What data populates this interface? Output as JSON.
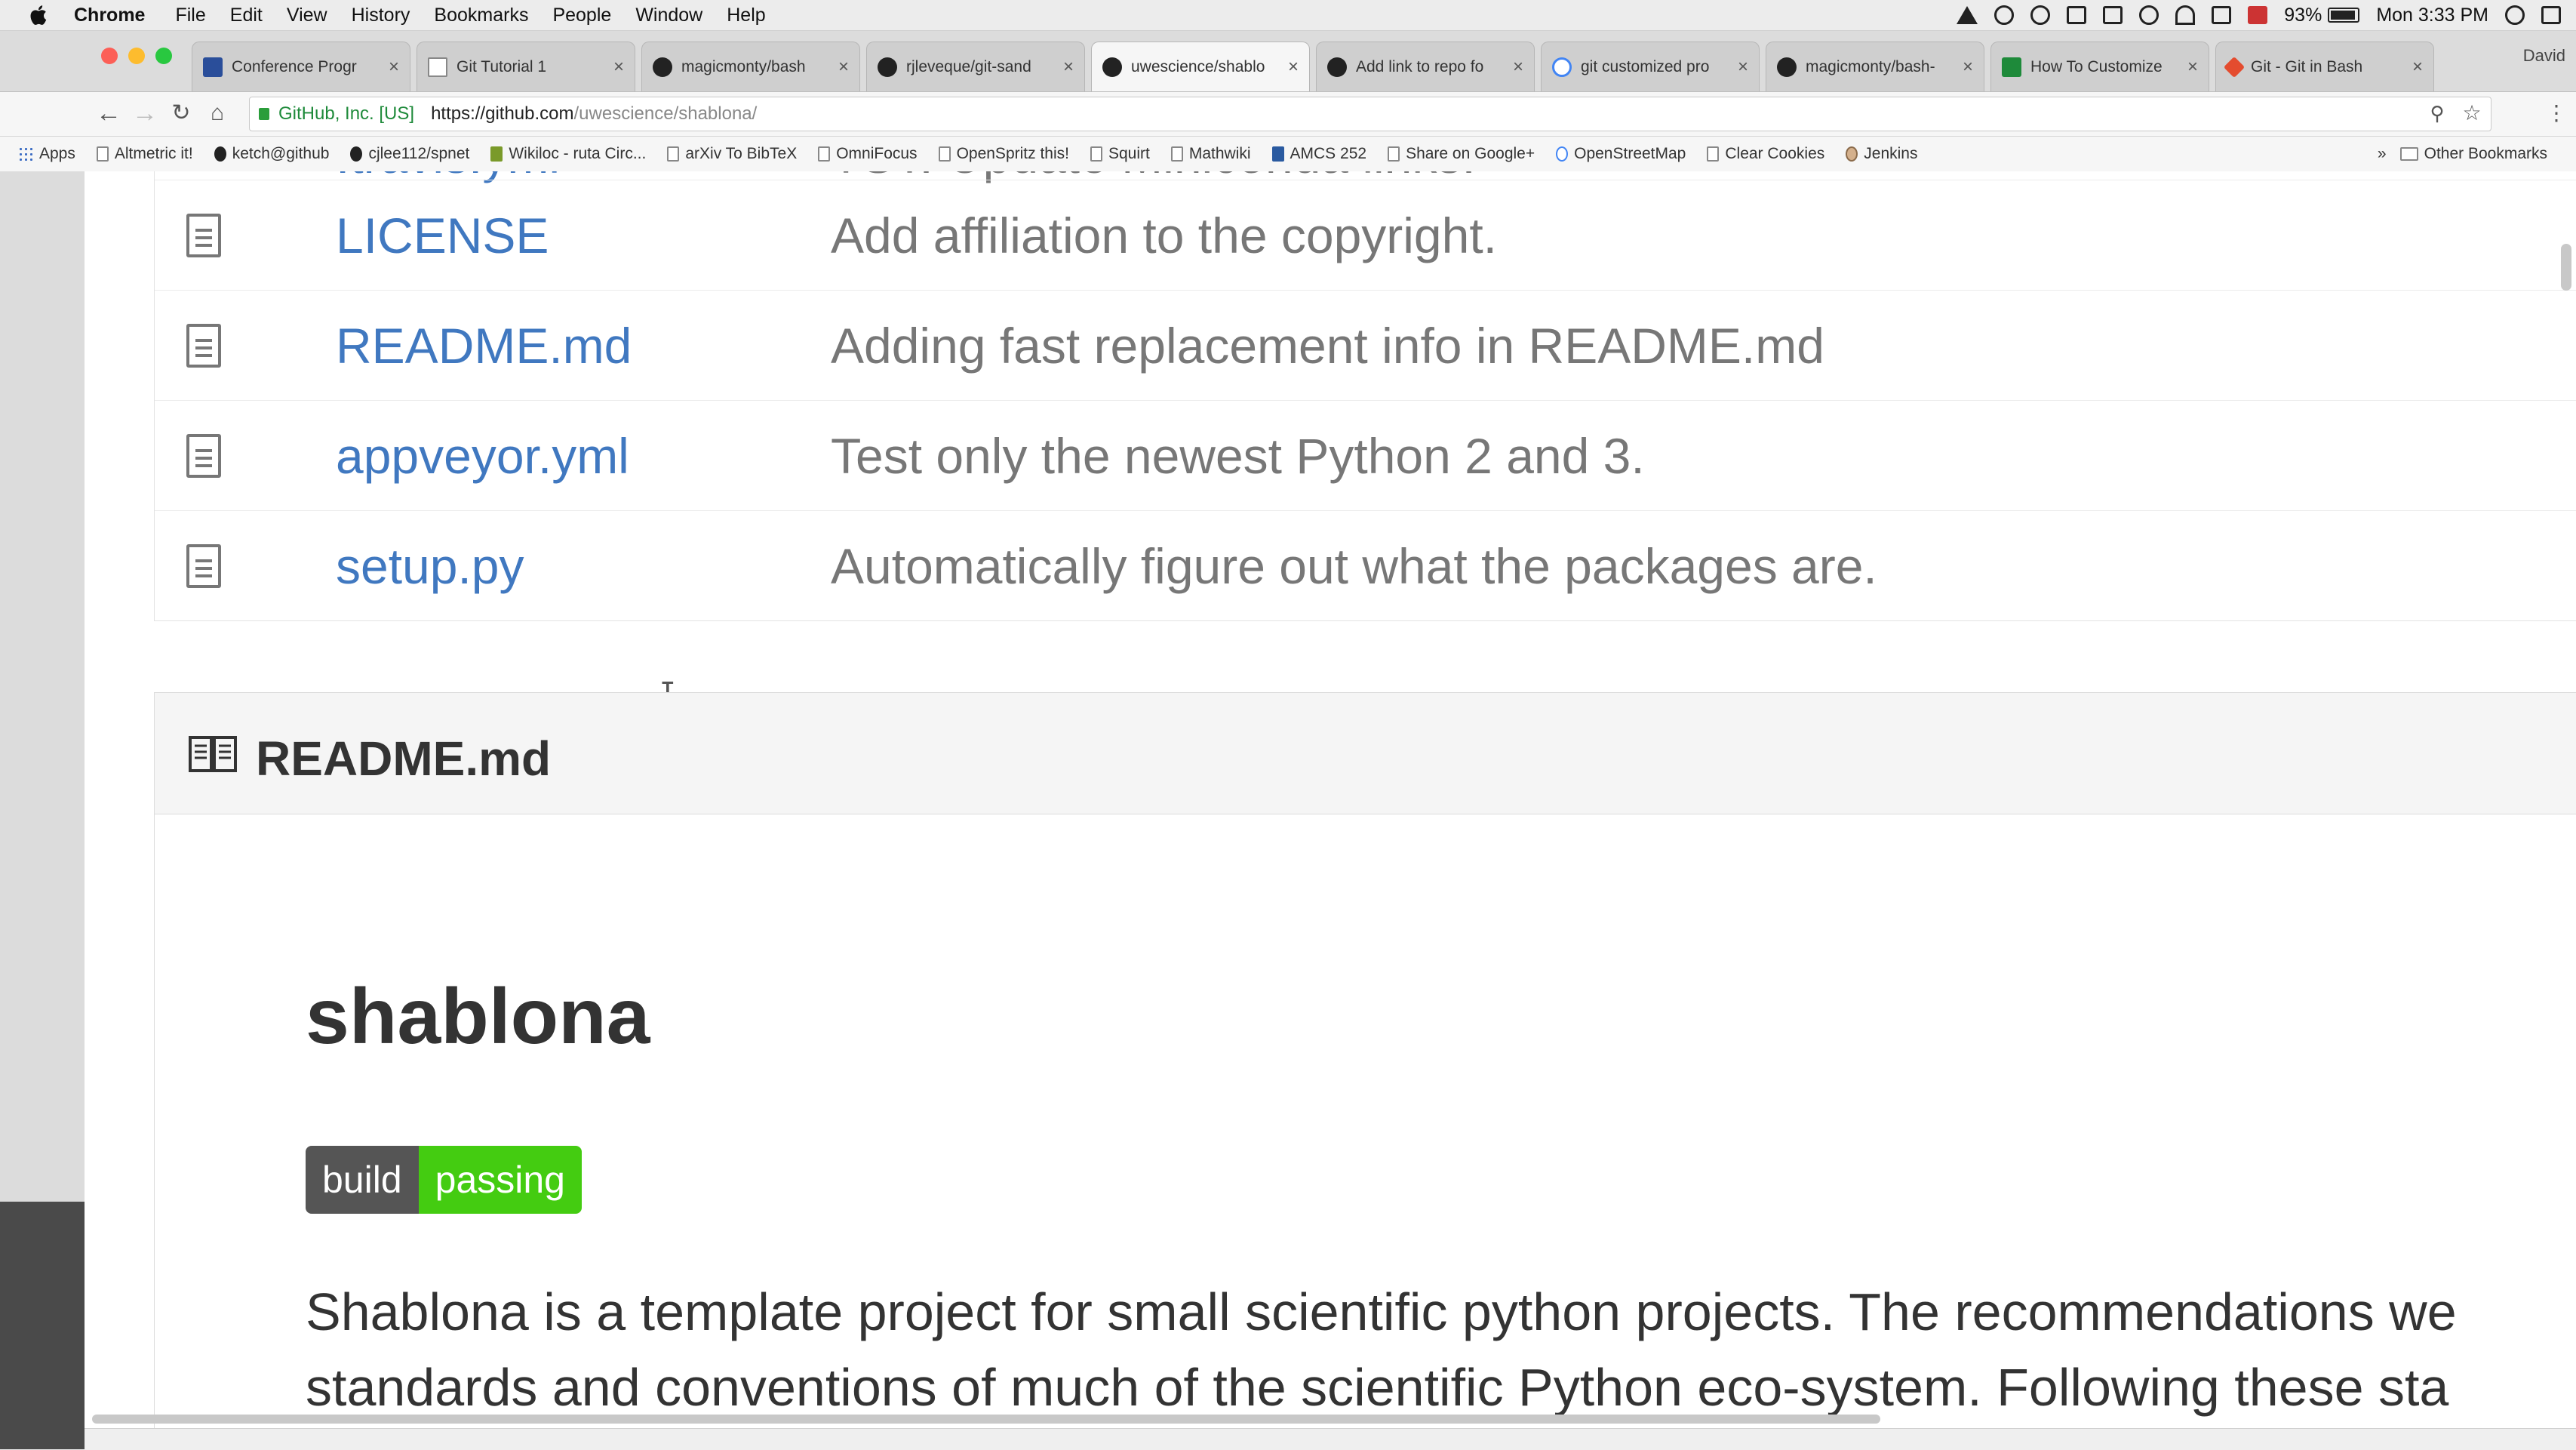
{
  "menubar": {
    "app": "Chrome",
    "items": [
      "File",
      "Edit",
      "View",
      "History",
      "Bookmarks",
      "People",
      "Window",
      "Help"
    ],
    "battery": "93%",
    "clock": "Mon 3:33 PM"
  },
  "tabs": [
    {
      "label": "Conference Progr",
      "icon": "blue"
    },
    {
      "label": "Git Tutorial 1",
      "icon": "doc"
    },
    {
      "label": "magicmonty/bash",
      "icon": "github"
    },
    {
      "label": "rjleveque/git-sand",
      "icon": "github"
    },
    {
      "label": "uwescience/shablo",
      "icon": "github"
    },
    {
      "label": "Add link to repo fo",
      "icon": "github"
    },
    {
      "label": "git customized pro",
      "icon": "google"
    },
    {
      "label": "magicmonty/bash-",
      "icon": "github"
    },
    {
      "label": "How To Customize",
      "icon": "green"
    },
    {
      "label": "Git - Git in Bash",
      "icon": "git"
    }
  ],
  "profile": "David",
  "address": {
    "ev_label": "GitHub, Inc. [US]",
    "url_host": "https://github.com",
    "url_path": "/uwescience/shablona/"
  },
  "bookmarks": {
    "items": [
      "Apps",
      "Altmetric it!",
      "ketch@github",
      "cjlee112/spnet",
      "Wikiloc - ruta Circ...",
      "arXiv To BibTeX",
      "OmniFocus",
      "OpenSpritz this!",
      "Squirt",
      "Mathwiki",
      "AMCS 252",
      "Share on Google+",
      "OpenStreetMap",
      "Clear Cookies",
      "Jenkins"
    ],
    "other": "Other Bookmarks"
  },
  "files": [
    {
      "name": ".travis.yml",
      "message": "TST: Update Miniconda links."
    },
    {
      "name": "LICENSE",
      "message": "Add affiliation to the copyright."
    },
    {
      "name": "README.md",
      "message": "Adding fast replacement info in README.md"
    },
    {
      "name": "appveyor.yml",
      "message": "Test only the newest Python 2 and 3."
    },
    {
      "name": "setup.py",
      "message": "Automatically figure out what the packages are."
    }
  ],
  "readme": {
    "header": "README.md",
    "title": "shablona",
    "badge_left": "build",
    "badge_right": "passing",
    "line1": "Shablona is a template project for small scientific python projects. The recommendations we",
    "line2": "standards and conventions of much of the scientific Python eco-system. Following these sta"
  },
  "colors": {
    "link": "#4078c0",
    "badge_green": "#44cc11",
    "badge_gray": "#555555"
  }
}
